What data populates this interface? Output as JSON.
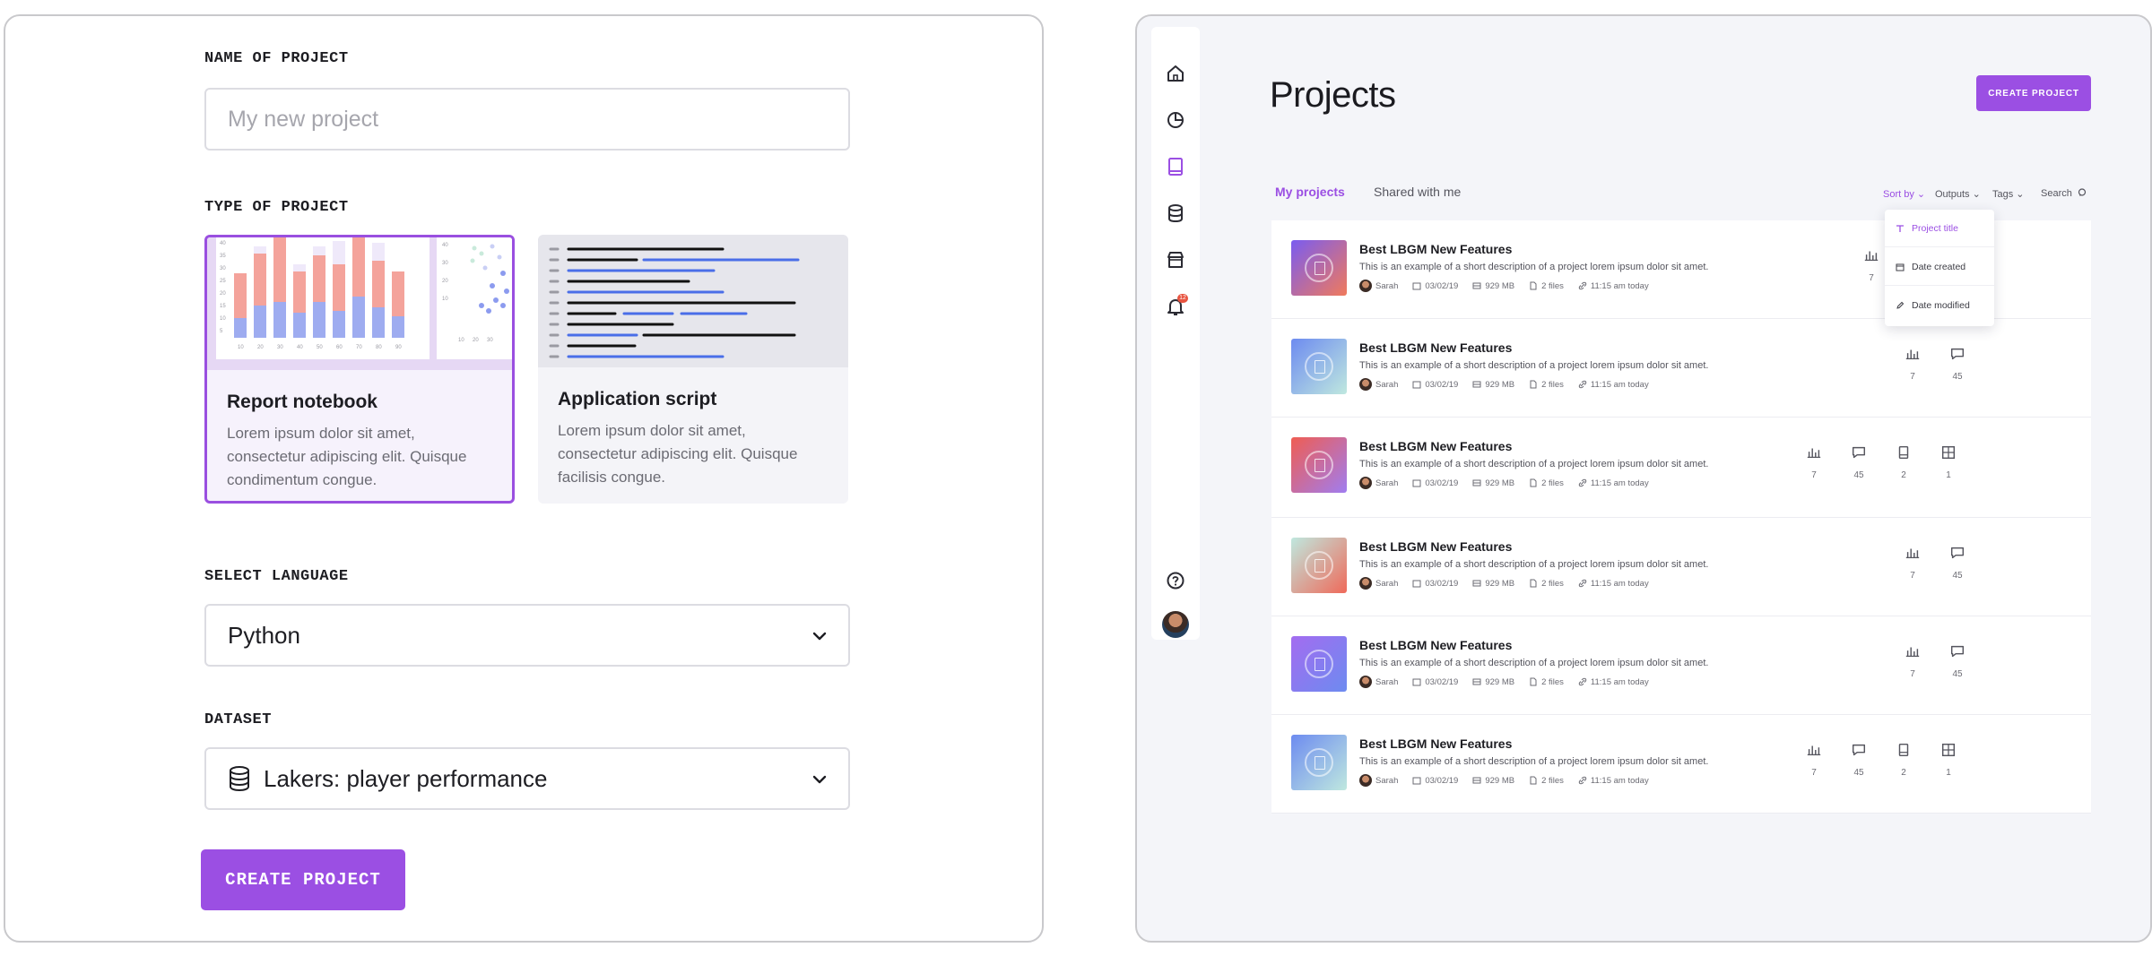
{
  "form": {
    "name_label": "NAME OF PROJECT",
    "name_placeholder": "My new project",
    "type_label": "TYPE OF PROJECT",
    "types": [
      {
        "title": "Report notebook",
        "desc": "Lorem ipsum dolor sit amet, consectetur adipiscing elit. Quisque condimentum congue."
      },
      {
        "title": "Application script",
        "desc": "Lorem ipsum dolor sit amet, consectetur adipiscing elit. Quisque facilisis congue."
      }
    ],
    "language_label": "SELECT LANGUAGE",
    "language_value": "Python",
    "dataset_label": "DATASET",
    "dataset_value": "Lakers: player performance",
    "create_label": "CREATE PROJECT"
  },
  "projects_page": {
    "title": "Projects",
    "create_label": "CREATE PROJECT",
    "tabs": [
      "My projects",
      "Shared with me"
    ],
    "filters": [
      "Sort by",
      "Outputs",
      "Tags",
      "Search"
    ],
    "sort_options": [
      "Project title",
      "Date created",
      "Date modified"
    ],
    "notification_count": "12",
    "rows": [
      {
        "title": "Best LBGM New Features",
        "desc": "This is an example of a short description of a project lorem ipsum dolor sit amet.",
        "user": "Sarah",
        "date": "03/02/19",
        "size": "929 MB",
        "files": "2 files",
        "time": "11:15 am today",
        "stats": [
          "7"
        ]
      },
      {
        "title": "Best LBGM New Features",
        "desc": "This is an example of a short description of a project lorem ipsum dolor sit amet.",
        "user": "Sarah",
        "date": "03/02/19",
        "size": "929 MB",
        "files": "2 files",
        "time": "11:15 am today",
        "stats": [
          "7",
          "45"
        ]
      },
      {
        "title": "Best LBGM New Features",
        "desc": "This is an example of a short description of a project lorem ipsum dolor sit amet.",
        "user": "Sarah",
        "date": "03/02/19",
        "size": "929 MB",
        "files": "2 files",
        "time": "11:15 am today",
        "stats": [
          "7",
          "45",
          "2",
          "1"
        ]
      },
      {
        "title": "Best LBGM New Features",
        "desc": "This is an example of a short description of a project lorem ipsum dolor sit amet.",
        "user": "Sarah",
        "date": "03/02/19",
        "size": "929 MB",
        "files": "2 files",
        "time": "11:15 am today",
        "stats": [
          "7",
          "45"
        ]
      },
      {
        "title": "Best LBGM New Features",
        "desc": "This is an example of a short description of a project lorem ipsum dolor sit amet.",
        "user": "Sarah",
        "date": "03/02/19",
        "size": "929 MB",
        "files": "2 files",
        "time": "11:15 am today",
        "stats": [
          "7",
          "45"
        ]
      },
      {
        "title": "Best LBGM New Features",
        "desc": "This is an example of a short description of a project lorem ipsum dolor sit amet.",
        "user": "Sarah",
        "date": "03/02/19",
        "size": "929 MB",
        "files": "2 files",
        "time": "11:15 am today",
        "stats": [
          "7",
          "45",
          "2",
          "1"
        ]
      }
    ]
  },
  "colors": {
    "accent": "#9b4fe3",
    "badge": "#e8533f"
  },
  "icons": [
    "home-icon",
    "pie-chart-icon",
    "notebook-icon",
    "database-icon",
    "store-icon",
    "bell-icon",
    "help-icon",
    "chevron-down-icon",
    "bar-chart-icon",
    "comment-icon",
    "grid-icon"
  ]
}
